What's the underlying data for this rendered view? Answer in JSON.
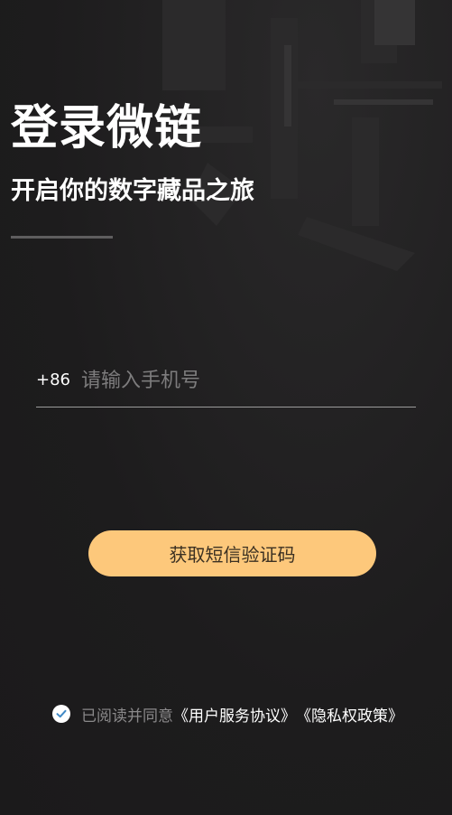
{
  "header": {
    "title": "登录微链",
    "subtitle": "开启你的数字藏品之旅"
  },
  "phone": {
    "country_code": "+86",
    "placeholder": "请输入手机号",
    "value": ""
  },
  "actions": {
    "sms_button_label": "获取短信验证码"
  },
  "agreement": {
    "checked": true,
    "prefix": "已阅读并同意",
    "user_agreement": "《用户服务协议》",
    "privacy_policy": "《隐私权政策》"
  },
  "colors": {
    "background": "#1d1c1d",
    "accent": "#fdc87b",
    "check_mark": "#3f88c5"
  },
  "icons": {
    "agreement_check": "check-circle-icon"
  }
}
